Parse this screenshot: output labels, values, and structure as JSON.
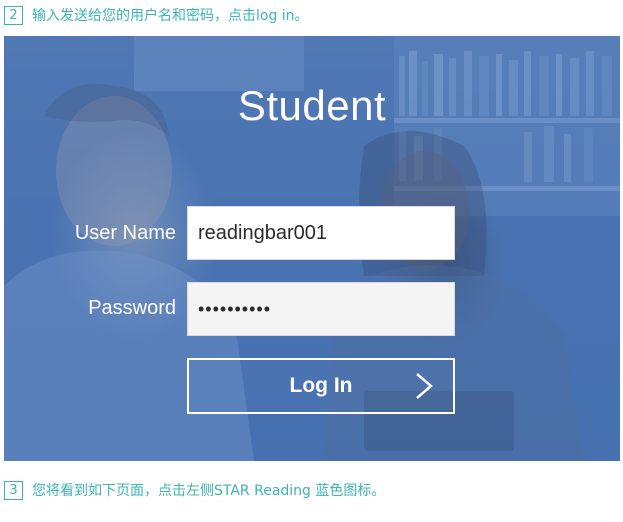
{
  "steps": [
    {
      "number": "2",
      "text": "输入发送给您的用户名和密码，点击log in。"
    },
    {
      "number": "3",
      "text": "您将看到如下页面，点击左侧STAR Reading 蓝色图标。"
    }
  ],
  "login": {
    "title": "Student",
    "username_label": "User Name",
    "username_value": "readingbar001",
    "password_label": "Password",
    "password_value": "••••••••••",
    "button_label": "Log In",
    "button_icon": "chevron-right-icon"
  },
  "colors": {
    "step_accent": "#3cb4b4",
    "panel_blue": "#4a72b0"
  }
}
